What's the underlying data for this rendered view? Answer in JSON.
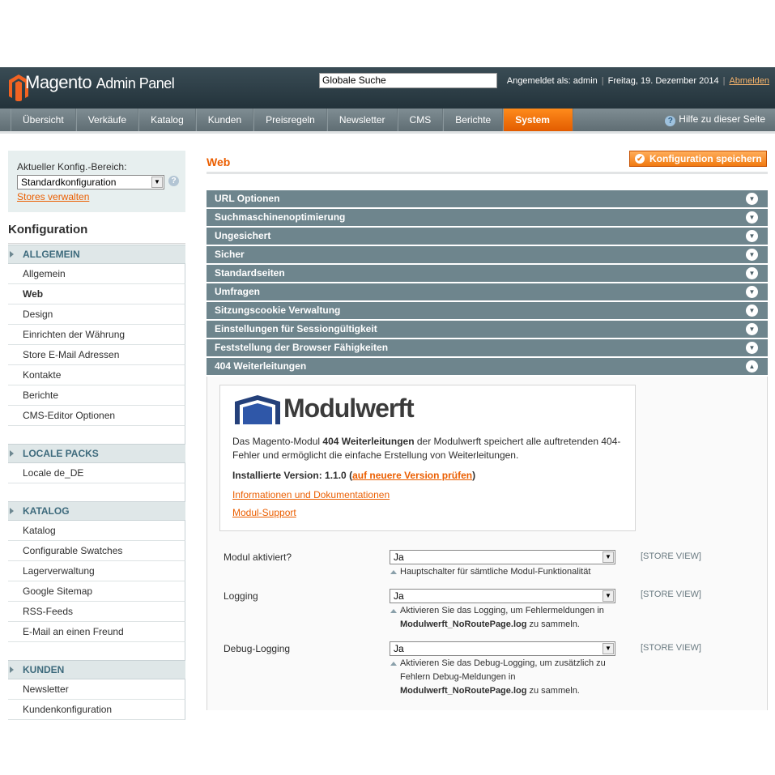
{
  "header": {
    "logo": "Magento",
    "logo_sub": "Admin Panel",
    "search_value": "Globale Suche",
    "logged_in": "Angemeldet als: admin",
    "date": "Freitag, 19. Dezember 2014",
    "logout": "Abmelden"
  },
  "nav": {
    "items": [
      "Übersicht",
      "Verkäufe",
      "Katalog",
      "Kunden",
      "Preisregeln",
      "Newsletter",
      "CMS",
      "Berichte",
      "System"
    ],
    "help": "Hilfe zu dieser Seite"
  },
  "sidebar": {
    "scope_label": "Aktueller Konfig.-Bereich:",
    "scope_value": "Standardkonfiguration",
    "stores_link": "Stores verwalten",
    "title": "Konfiguration",
    "groups": [
      {
        "name": "ALLGEMEIN",
        "items": [
          "Allgemein",
          "Web",
          "Design",
          "Einrichten der Währung",
          "Store E-Mail Adressen",
          "Kontakte",
          "Berichte",
          "CMS-Editor Optionen"
        ]
      },
      {
        "name": "LOCALE PACKS",
        "items": [
          "Locale de_DE"
        ]
      },
      {
        "name": "KATALOG",
        "items": [
          "Katalog",
          "Configurable Swatches",
          "Lagerverwaltung",
          "Google Sitemap",
          "RSS-Feeds",
          "E-Mail an einen Freund"
        ]
      },
      {
        "name": "KUNDEN",
        "items": [
          "Newsletter",
          "Kundenkonfiguration"
        ]
      }
    ]
  },
  "main": {
    "title": "Web",
    "save_button": "Konfiguration speichern",
    "sections": [
      "URL Optionen",
      "Suchmaschinenoptimierung",
      "Ungesichert",
      "Sicher",
      "Standardseiten",
      "Umfragen",
      "Sitzungscookie Verwaltung",
      "Einstellungen für Sessiongültigkeit",
      "Feststellung der Browser Fähigkeiten",
      "404 Weiterleitungen"
    ],
    "modulwerft": {
      "logo_text": "Modulwerft",
      "desc_pre": "Das Magento-Modul ",
      "desc_bold": "404 Weiterleitungen",
      "desc_post": " der Modulwerft speichert alle auftretenden 404-Fehler und ermöglicht die einfache Erstellung von Weiterleitungen.",
      "version_label": "Installierte Version: 1.1.0 (",
      "version_link": "auf neuere Version prüfen",
      "version_close": ")",
      "info_link": "Informationen und Dokumentationen",
      "support_link": "Modul-Support"
    },
    "fields": [
      {
        "label": "Modul aktiviert?",
        "value": "Ja",
        "scope": "[STORE VIEW]",
        "note_pre": "Hauptschalter für sämtliche Modul-Funktionalität",
        "note_bold": "",
        "note_post": ""
      },
      {
        "label": "Logging",
        "value": "Ja",
        "scope": "[STORE VIEW]",
        "note_pre": "Aktivieren Sie das Logging, um Fehlermeldungen in ",
        "note_bold": "Modulwerft_NoRoutePage.log",
        "note_post": " zu sammeln."
      },
      {
        "label": "Debug-Logging",
        "value": "Ja",
        "scope": "[STORE VIEW]",
        "note_pre": "Aktivieren Sie das Debug-Logging, um zusätzlich zu Fehlern Debug-Meldungen in ",
        "note_bold": "Modulwerft_NoRoutePage.log",
        "note_post": " zu sammeln."
      }
    ]
  },
  "colors": {
    "accent": "#eb5e00",
    "section_bar": "#6e858d",
    "header": "#2b3c44"
  },
  "icons": [
    "magento-logo-icon",
    "help-icon",
    "chevron-down-icon",
    "chevron-up-icon",
    "checkmark-icon",
    "modulwerft-logo-icon"
  ]
}
